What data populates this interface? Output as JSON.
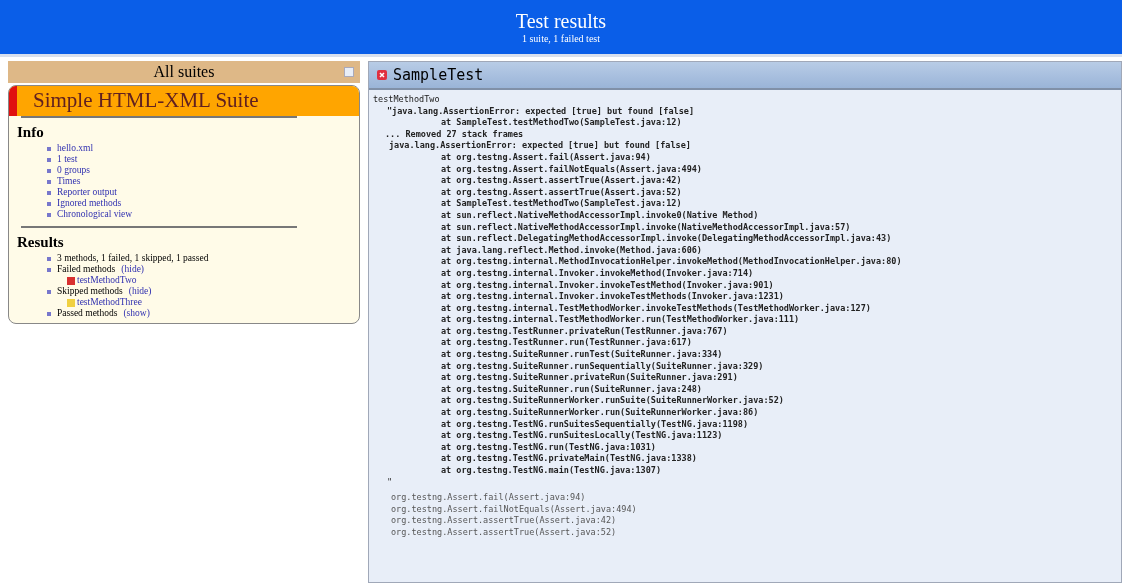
{
  "header": {
    "title": "Test results",
    "subtitle": "1 suite, 1 failed test"
  },
  "sidebar": {
    "title": "All suites",
    "suite": {
      "name": "Simple HTML-XML Suite",
      "failed": true
    },
    "info": {
      "heading": "Info",
      "items": [
        "hello.xml",
        "1 test",
        "0 groups",
        "Times",
        "Reporter output",
        "Ignored methods",
        "Chronological view"
      ]
    },
    "results": {
      "heading": "Results",
      "summary": "3 methods, 1 failed, 1 skipped, 1 passed",
      "groups": [
        {
          "label": "Failed methods",
          "toggle": "(hide)",
          "kind": "failed",
          "methods": [
            "testMethodTwo"
          ]
        },
        {
          "label": "Skipped methods",
          "toggle": "(hide)",
          "kind": "skipped",
          "methods": [
            "testMethodThree"
          ]
        },
        {
          "label": "Passed methods",
          "toggle": "(show)"
        }
      ]
    }
  },
  "detail": {
    "class_name": "SampleTest",
    "failed": true,
    "method": "testMethodTwo",
    "lines": [
      {
        "kind": "quote",
        "text": "\"java.lang.AssertionError: expected [true] but found [false]"
      },
      {
        "kind": "frame",
        "text": "at SampleTest.testMethodTwo(SampleTest.java:12)"
      },
      {
        "kind": "note",
        "text": "... Removed 27 stack frames"
      },
      {
        "kind": "message",
        "text": "java.lang.AssertionError: expected [true] but found [false]"
      },
      {
        "kind": "frame",
        "text": "at org.testng.Assert.fail(Assert.java:94)"
      },
      {
        "kind": "frame",
        "text": "at org.testng.Assert.failNotEquals(Assert.java:494)"
      },
      {
        "kind": "frame",
        "text": "at org.testng.Assert.assertTrue(Assert.java:42)"
      },
      {
        "kind": "frame",
        "text": "at org.testng.Assert.assertTrue(Assert.java:52)"
      },
      {
        "kind": "frame",
        "text": "at SampleTest.testMethodTwo(SampleTest.java:12)"
      },
      {
        "kind": "frame",
        "text": "at sun.reflect.NativeMethodAccessorImpl.invoke0(Native Method)"
      },
      {
        "kind": "frame",
        "text": "at sun.reflect.NativeMethodAccessorImpl.invoke(NativeMethodAccessorImpl.java:57)"
      },
      {
        "kind": "frame",
        "text": "at sun.reflect.DelegatingMethodAccessorImpl.invoke(DelegatingMethodAccessorImpl.java:43)"
      },
      {
        "kind": "frame",
        "text": "at java.lang.reflect.Method.invoke(Method.java:606)"
      },
      {
        "kind": "frame",
        "text": "at org.testng.internal.MethodInvocationHelper.invokeMethod(MethodInvocationHelper.java:80)"
      },
      {
        "kind": "frame",
        "text": "at org.testng.internal.Invoker.invokeMethod(Invoker.java:714)"
      },
      {
        "kind": "frame",
        "text": "at org.testng.internal.Invoker.invokeTestMethod(Invoker.java:901)"
      },
      {
        "kind": "frame",
        "text": "at org.testng.internal.Invoker.invokeTestMethods(Invoker.java:1231)"
      },
      {
        "kind": "frame",
        "text": "at org.testng.internal.TestMethodWorker.invokeTestMethods(TestMethodWorker.java:127)"
      },
      {
        "kind": "frame",
        "text": "at org.testng.internal.TestMethodWorker.run(TestMethodWorker.java:111)"
      },
      {
        "kind": "frame",
        "text": "at org.testng.TestRunner.privateRun(TestRunner.java:767)"
      },
      {
        "kind": "frame",
        "text": "at org.testng.TestRunner.run(TestRunner.java:617)"
      },
      {
        "kind": "frame",
        "text": "at org.testng.SuiteRunner.runTest(SuiteRunner.java:334)"
      },
      {
        "kind": "frame",
        "text": "at org.testng.SuiteRunner.runSequentially(SuiteRunner.java:329)"
      },
      {
        "kind": "frame",
        "text": "at org.testng.SuiteRunner.privateRun(SuiteRunner.java:291)"
      },
      {
        "kind": "frame",
        "text": "at org.testng.SuiteRunner.run(SuiteRunner.java:248)"
      },
      {
        "kind": "frame",
        "text": "at org.testng.SuiteRunnerWorker.runSuite(SuiteRunnerWorker.java:52)"
      },
      {
        "kind": "frame",
        "text": "at org.testng.SuiteRunnerWorker.run(SuiteRunnerWorker.java:86)"
      },
      {
        "kind": "frame",
        "text": "at org.testng.TestNG.runSuitesSequentially(TestNG.java:1198)"
      },
      {
        "kind": "frame",
        "text": "at org.testng.TestNG.runSuitesLocally(TestNG.java:1123)"
      },
      {
        "kind": "frame",
        "text": "at org.testng.TestNG.run(TestNG.java:1031)"
      },
      {
        "kind": "frame",
        "text": "at org.testng.TestNG.privateMain(TestNG.java:1338)"
      },
      {
        "kind": "frame",
        "text": "at org.testng.TestNG.main(TestNG.java:1307)"
      },
      {
        "kind": "close",
        "text": "\""
      },
      {
        "kind": "plain",
        "text": "org.testng.Assert.fail(Assert.java:94)"
      },
      {
        "kind": "plain",
        "text": "org.testng.Assert.failNotEquals(Assert.java:494)"
      },
      {
        "kind": "plain",
        "text": "org.testng.Assert.assertTrue(Assert.java:42)"
      },
      {
        "kind": "plain",
        "text": "org.testng.Assert.assertTrue(Assert.java:52)"
      }
    ]
  }
}
